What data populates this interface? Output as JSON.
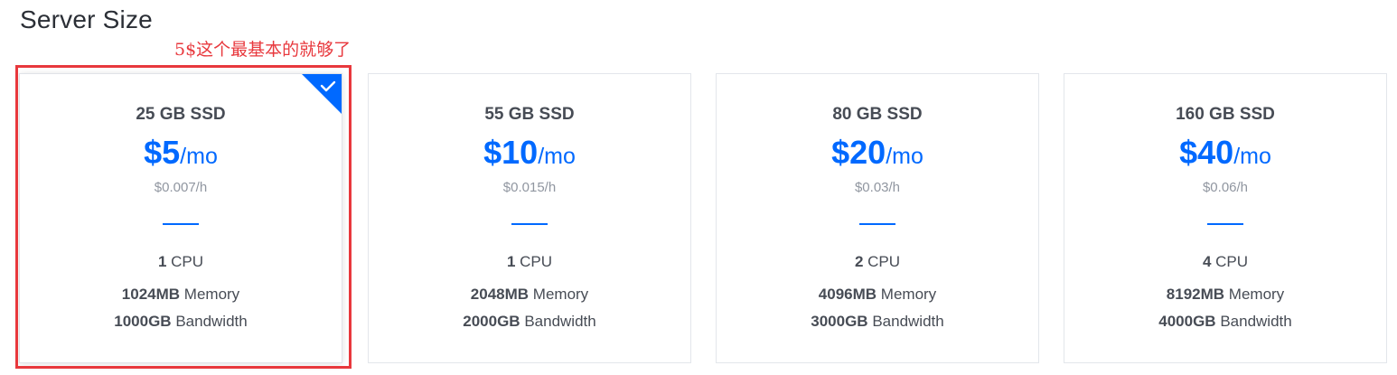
{
  "section": {
    "title": "Server Size",
    "annotation": "5$这个最基本的就够了"
  },
  "colors": {
    "accent": "#0069ff",
    "annotation_red": "#e8383d",
    "text_dark": "#474c55",
    "text_muted": "#9096a0"
  },
  "selected_plan_index": 0,
  "plans": [
    {
      "disk": "25 GB SSD",
      "price": "$5",
      "price_unit": "/mo",
      "hourly": "$0.007/h",
      "cpu_count": "1",
      "cpu_label": " CPU",
      "memory_value": "1024MB",
      "memory_label": " Memory",
      "bandwidth_value": "1000GB",
      "bandwidth_label": " Bandwidth",
      "check_icon": "check-icon"
    },
    {
      "disk": "55 GB SSD",
      "price": "$10",
      "price_unit": "/mo",
      "hourly": "$0.015/h",
      "cpu_count": "1",
      "cpu_label": " CPU",
      "memory_value": "2048MB",
      "memory_label": " Memory",
      "bandwidth_value": "2000GB",
      "bandwidth_label": " Bandwidth"
    },
    {
      "disk": "80 GB SSD",
      "price": "$20",
      "price_unit": "/mo",
      "hourly": "$0.03/h",
      "cpu_count": "2",
      "cpu_label": " CPU",
      "memory_value": "4096MB",
      "memory_label": " Memory",
      "bandwidth_value": "3000GB",
      "bandwidth_label": " Bandwidth"
    },
    {
      "disk": "160 GB SSD",
      "price": "$40",
      "price_unit": "/mo",
      "hourly": "$0.06/h",
      "cpu_count": "4",
      "cpu_label": " CPU",
      "memory_value": "8192MB",
      "memory_label": " Memory",
      "bandwidth_value": "4000GB",
      "bandwidth_label": " Bandwidth"
    }
  ]
}
